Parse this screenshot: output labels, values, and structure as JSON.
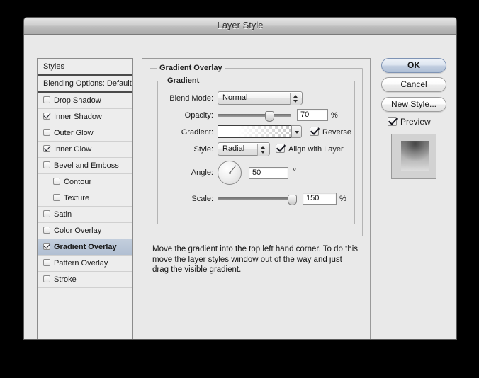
{
  "window": {
    "title": "Layer Style"
  },
  "styles_list": {
    "header_label": "Styles",
    "blending_options_label": "Blending Options: Default",
    "items": [
      {
        "label": "Drop Shadow",
        "checked": false,
        "indent": false,
        "selected": false
      },
      {
        "label": "Inner Shadow",
        "checked": true,
        "indent": false,
        "selected": false
      },
      {
        "label": "Outer Glow",
        "checked": false,
        "indent": false,
        "selected": false
      },
      {
        "label": "Inner Glow",
        "checked": true,
        "indent": false,
        "selected": false
      },
      {
        "label": "Bevel and Emboss",
        "checked": false,
        "indent": false,
        "selected": false
      },
      {
        "label": "Contour",
        "checked": false,
        "indent": true,
        "selected": false
      },
      {
        "label": "Texture",
        "checked": false,
        "indent": true,
        "selected": false
      },
      {
        "label": "Satin",
        "checked": false,
        "indent": false,
        "selected": false
      },
      {
        "label": "Color Overlay",
        "checked": false,
        "indent": false,
        "selected": false
      },
      {
        "label": "Gradient Overlay",
        "checked": true,
        "indent": false,
        "selected": true
      },
      {
        "label": "Pattern Overlay",
        "checked": false,
        "indent": false,
        "selected": false
      },
      {
        "label": "Stroke",
        "checked": false,
        "indent": false,
        "selected": false
      }
    ]
  },
  "main_panel": {
    "group_title": "Gradient Overlay",
    "gradient_group_title": "Gradient",
    "blend_mode": {
      "label": "Blend Mode:",
      "value": "Normal"
    },
    "opacity": {
      "label": "Opacity:",
      "value": "70",
      "unit": "%",
      "percent": 70
    },
    "gradient": {
      "label": "Gradient:",
      "reverse_label": "Reverse",
      "reverse_checked": true
    },
    "style": {
      "label": "Style:",
      "value": "Radial",
      "align_label": "Align with Layer",
      "align_checked": true
    },
    "angle": {
      "label": "Angle:",
      "value": "50",
      "unit": "°"
    },
    "scale": {
      "label": "Scale:",
      "value": "150",
      "unit": "%",
      "percent": 93
    },
    "instructions": "Move the gradient into the top left hand corner. To do this move the layer styles window out of the way and just drag the visible gradient."
  },
  "buttons": {
    "ok": "OK",
    "cancel": "Cancel",
    "new_style": "New Style...",
    "preview_label": "Preview",
    "preview_checked": true
  },
  "colors": {
    "dialog_bg": "#e9e9e9",
    "selection": "#b1bfd2",
    "default_button": "#aebfd6",
    "desktop": "#000000"
  }
}
